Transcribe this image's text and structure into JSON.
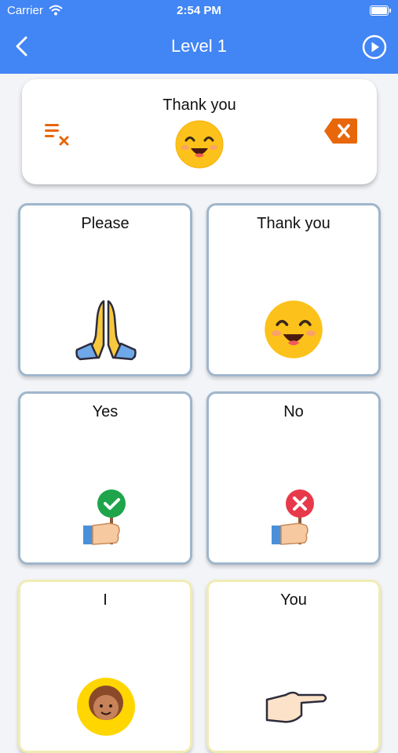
{
  "status_bar": {
    "carrier": "Carrier",
    "time": "2:54 PM"
  },
  "nav": {
    "title": "Level 1"
  },
  "sentence": {
    "words": [
      "Thank you"
    ]
  },
  "cards": [
    {
      "label": "Please",
      "icon": "praying-hands-icon"
    },
    {
      "label": "Thank you",
      "icon": "smiling-face-icon"
    },
    {
      "label": "Yes",
      "icon": "yes-sign-icon"
    },
    {
      "label": "No",
      "icon": "no-sign-icon"
    },
    {
      "label": "I",
      "icon": "child-face-icon"
    },
    {
      "label": "You",
      "icon": "pointing-hand-icon"
    }
  ],
  "colors": {
    "nav": "#4285f4",
    "accent_orange": "#e8670a",
    "card_border_blue": "#9fb6cc",
    "card_border_yellow": "#f1ecb4"
  }
}
